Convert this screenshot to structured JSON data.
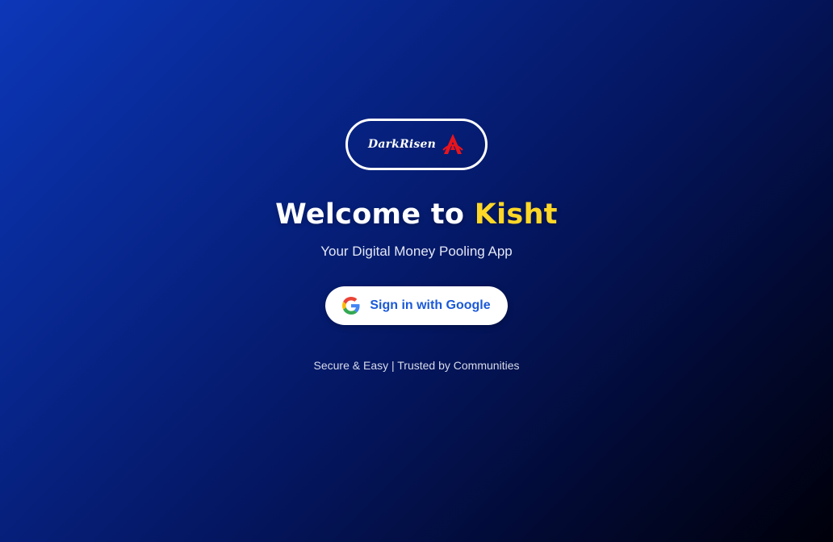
{
  "logo": {
    "text": "DarkRisen",
    "mark_icon": "red-a-emblem-icon",
    "mark_color": "#e8141c"
  },
  "headline": {
    "prefix": "Welcome to ",
    "brand": "Kisht",
    "brand_color": "#ffd727"
  },
  "tagline": "Your Digital Money Pooling App",
  "signin_button": {
    "label": "Sign in with Google",
    "icon": "google-g-icon"
  },
  "footer_note": "Secure & Easy | Trusted by Communities",
  "colors": {
    "background_start": "#0c37b8",
    "background_end": "#00000a",
    "button_text": "#1b59d8"
  }
}
